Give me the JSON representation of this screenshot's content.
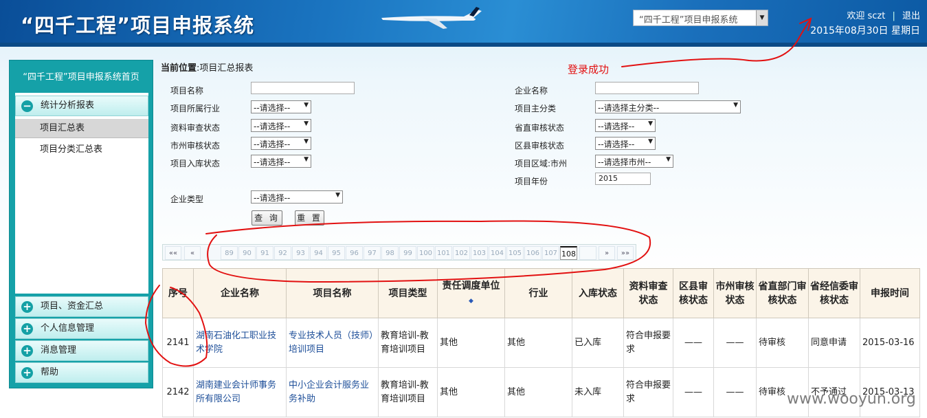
{
  "header": {
    "title": "“四千工程”项目申报系统",
    "system_select": "“四千工程”项目申报系统",
    "welcome": "欢迎",
    "username": "sczt",
    "logout": "退出",
    "date": "2015年08月30日",
    "weekday": "星期日"
  },
  "sidebar": {
    "home": "“四千工程”项目申报系统首页",
    "sections": [
      {
        "label": "统计分析报表",
        "expanded": true,
        "icon": "minus-circle-icon"
      },
      {
        "label": "项目、资金汇总",
        "icon": "plus-circle-icon"
      },
      {
        "label": "个人信息管理",
        "icon": "plus-circle-icon"
      },
      {
        "label": "消息管理",
        "icon": "plus-circle-icon"
      },
      {
        "label": "帮助",
        "icon": "plus-circle-icon"
      }
    ],
    "sub_items": [
      "项目汇总表",
      "项目分类汇总表"
    ]
  },
  "breadcrumb": {
    "prefix": "当前位置",
    "page": ":项目汇总报表"
  },
  "annotation": "登录成功",
  "filters": {
    "project_name": "项目名称",
    "company_name": "企业名称",
    "industry": "项目所属行业",
    "main_category": "项目主分类",
    "material_review": "资料审查状态",
    "province_review": "省直审核状态",
    "city_review": "市州审核状态",
    "county_review": "区县审核状态",
    "warehouse": "项目入库状态",
    "region": "项目区域:市州",
    "year_label": "项目年份",
    "year_value": "2015",
    "company_type": "企业类型",
    "please_select": "--请选择--",
    "please_select_main": "--请选择主分类--",
    "please_select_city": "--请选择市州--",
    "query": "查 询",
    "reset": "重 置"
  },
  "pager": {
    "first": "««",
    "prev": "«",
    "next": "»",
    "last": "»»",
    "pages": [
      "89",
      "90",
      "91",
      "92",
      "93",
      "94",
      "95",
      "96",
      "97",
      "98",
      "99",
      "100",
      "101",
      "102",
      "103",
      "104",
      "105",
      "106",
      "107",
      "108"
    ],
    "current": "108"
  },
  "table": {
    "headers": [
      "序号",
      "企业名称",
      "项目名称",
      "项目类型",
      "责任调度单位",
      "行业",
      "入库状态",
      "资料审查状态",
      "区县审核状态",
      "市州审核状态",
      "省直部门审核状态",
      "省经信委审核状态",
      "申报时间"
    ],
    "rows": [
      [
        "2141",
        "湖南石油化工职业技术学院",
        "专业技术人员（技师）培训项目",
        "教育培训-教育培训项目",
        "其他",
        "其他",
        "已入库",
        "符合申报要求",
        "——",
        "——",
        "待审核",
        "同意申请",
        "2015-03-16"
      ],
      [
        "2142",
        "湖南建业会计师事务所有限公司",
        "中小企业会计服务业务补助",
        "教育培训-教育培训项目",
        "其他",
        "其他",
        "未入库",
        "符合申报要求",
        "——",
        "——",
        "待审核",
        "不予通过",
        "2015-03-13"
      ]
    ]
  },
  "watermark": "www.wooyun.org",
  "colors": {
    "header_blue": "#1a74c0",
    "sidebar_teal": "#15a1a8",
    "annotation_red": "#e21010",
    "link_blue": "#1e4f99"
  }
}
